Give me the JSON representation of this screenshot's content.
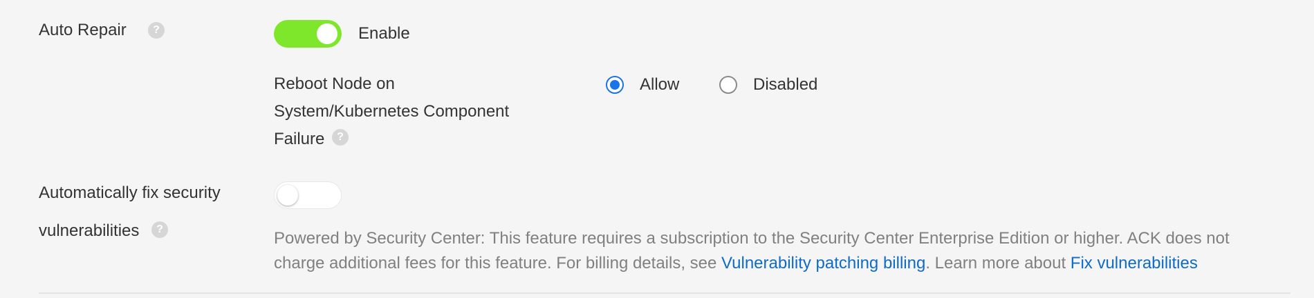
{
  "auto_repair": {
    "label": "Auto Repair",
    "help_icon": "?",
    "toggle_state": "on",
    "toggle_label": "Enable",
    "reboot": {
      "label_line1": "Reboot Node on",
      "label_line2": "System/Kubernetes Component",
      "label_line3": "Failure",
      "help_icon": "?",
      "options": [
        {
          "label": "Allow",
          "selected": true
        },
        {
          "label": "Disabled",
          "selected": false
        }
      ]
    }
  },
  "security_fix": {
    "label_line1": "Automatically fix security",
    "label_line2": "vulnerabilities",
    "help_icon": "?",
    "toggle_state": "off",
    "desc_line1": "Powered by Security Center: This feature requires a subscription to the Security Center Enterprise Edition or higher. ACK does not",
    "desc_line2_prefix": "charge additional fees for this feature. For billing details, see ",
    "billing_link": "Vulnerability patching billing",
    "desc_line2_mid": ". Learn more about ",
    "fix_link": "Fix vulnerabilities"
  },
  "colors": {
    "toggle_on": "#7ee72c",
    "accent": "#1a73e8",
    "link": "#0e6bc8"
  }
}
